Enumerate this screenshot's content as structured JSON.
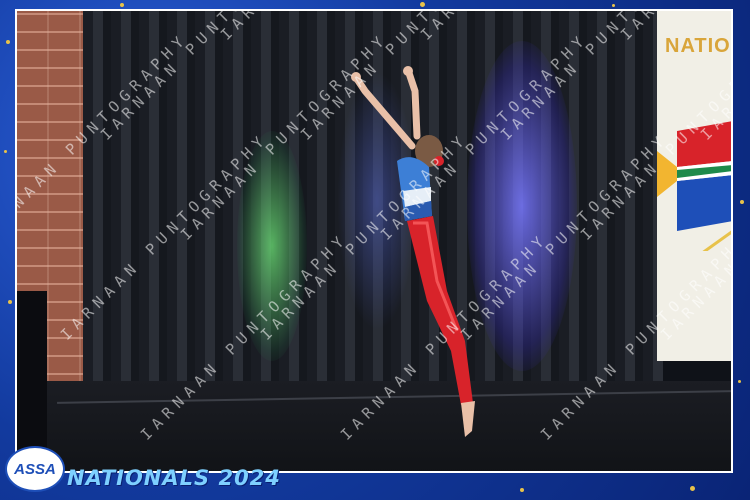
{
  "watermark": {
    "text": "IARNAAN PUNTOGRAPHY"
  },
  "banner": {
    "text": "NATIO"
  },
  "logo": {
    "text": "ASSA"
  },
  "event": {
    "title": "NATIONALS 2024"
  },
  "colors": {
    "frame_blue": "#123a9e",
    "leotard_red": "#d8232a",
    "leotard_blue": "#3d7fd6",
    "title_cyan": "#7ed0ff"
  },
  "icons": {
    "flag": "south-africa-flag-icon"
  }
}
